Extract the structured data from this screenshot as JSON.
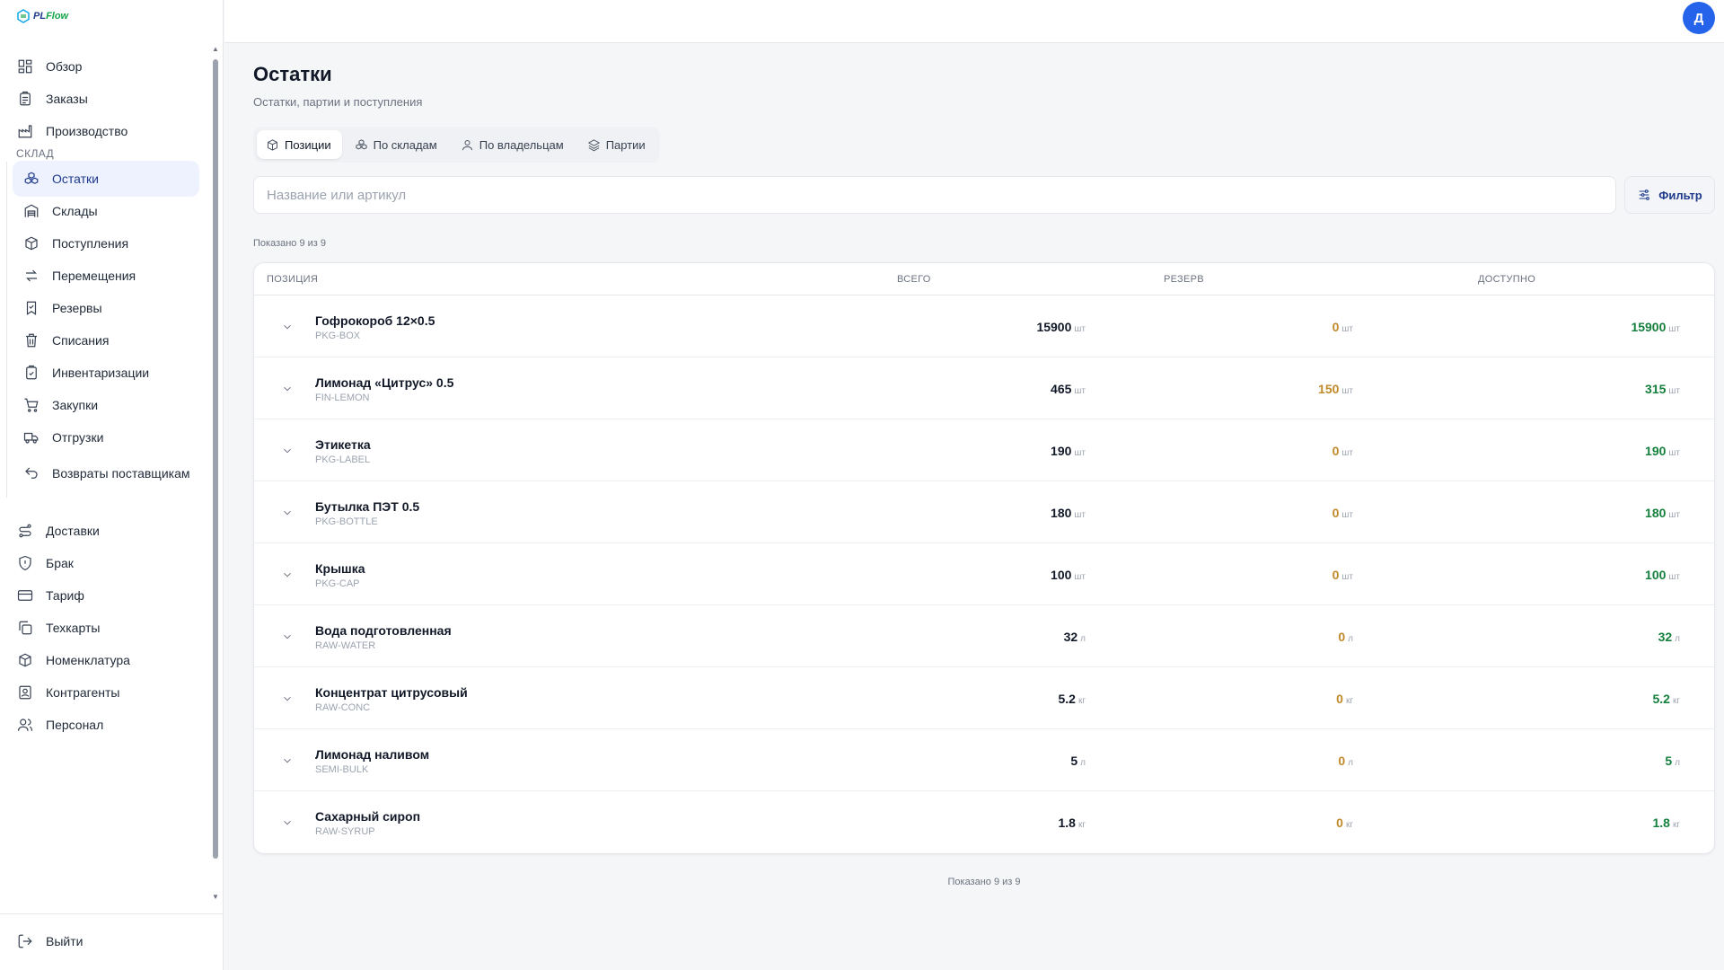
{
  "app": {
    "logo_main": "PL",
    "logo_accent": "Flow"
  },
  "user": {
    "avatar_letter": "Д"
  },
  "sidebar": {
    "top_items": [
      {
        "label": "Обзор",
        "icon": "dashboard-icon"
      },
      {
        "label": "Заказы",
        "icon": "clipboard-icon"
      },
      {
        "label": "Производство",
        "icon": "factory-icon"
      }
    ],
    "section_label": "СКЛАД",
    "warehouse_items": [
      {
        "label": "Остатки",
        "icon": "boxes-icon",
        "active": true
      },
      {
        "label": "Склады",
        "icon": "warehouse-icon"
      },
      {
        "label": "Поступления",
        "icon": "package-in-icon"
      },
      {
        "label": "Перемещения",
        "icon": "arrows-swap-icon"
      },
      {
        "label": "Резервы",
        "icon": "bookmark-icon"
      },
      {
        "label": "Списания",
        "icon": "trash-icon"
      },
      {
        "label": "Инвентаризации",
        "icon": "clipboard-check-icon"
      },
      {
        "label": "Закупки",
        "icon": "cart-icon"
      },
      {
        "label": "Отгрузки",
        "icon": "truck-icon"
      },
      {
        "label": "Возвраты поставщикам",
        "icon": "return-icon"
      }
    ],
    "bottom_items": [
      {
        "label": "Доставки",
        "icon": "route-icon"
      },
      {
        "label": "Брак",
        "icon": "shield-alert-icon"
      },
      {
        "label": "Тариф",
        "icon": "credit-card-icon"
      },
      {
        "label": "Техкарты",
        "icon": "copy-icon"
      },
      {
        "label": "Номенклатура",
        "icon": "box-icon"
      },
      {
        "label": "Контрагенты",
        "icon": "contact-icon"
      },
      {
        "label": "Персонал",
        "icon": "users-icon"
      }
    ],
    "logout_label": "Выйти"
  },
  "page": {
    "title": "Остатки",
    "subtitle": "Остатки, партии и поступления",
    "tabs": [
      {
        "label": "Позиции",
        "icon": "box-icon",
        "active": true
      },
      {
        "label": "По складам",
        "icon": "boxes-icon"
      },
      {
        "label": "По владельцам",
        "icon": "user-icon"
      },
      {
        "label": "Партии",
        "icon": "layers-icon"
      }
    ],
    "search_placeholder": "Название или артикул",
    "filter_label": "Фильтр",
    "shown_text": "Показано 9 из 9"
  },
  "table": {
    "headers": {
      "position": "Позиция",
      "total": "Всего",
      "reserve": "Резерв",
      "available": "Доступно"
    },
    "rows": [
      {
        "name": "Гофрокороб 12×0.5",
        "sku": "PKG-BOX",
        "total": "15900",
        "reserve": "0",
        "available": "15900",
        "unit": "шт"
      },
      {
        "name": "Лимонад «Цитрус» 0.5",
        "sku": "FIN-LEMON",
        "total": "465",
        "reserve": "150",
        "available": "315",
        "unit": "шт"
      },
      {
        "name": "Этикетка",
        "sku": "PKG-LABEL",
        "total": "190",
        "reserve": "0",
        "available": "190",
        "unit": "шт"
      },
      {
        "name": "Бутылка ПЭТ 0.5",
        "sku": "PKG-BOTTLE",
        "total": "180",
        "reserve": "0",
        "available": "180",
        "unit": "шт"
      },
      {
        "name": "Крышка",
        "sku": "PKG-CAP",
        "total": "100",
        "reserve": "0",
        "available": "100",
        "unit": "шт"
      },
      {
        "name": "Вода подготовленная",
        "sku": "RAW-WATER",
        "total": "32",
        "reserve": "0",
        "available": "32",
        "unit": "л"
      },
      {
        "name": "Концентрат цитрусовый",
        "sku": "RAW-CONC",
        "total": "5.2",
        "reserve": "0",
        "available": "5.2",
        "unit": "кг"
      },
      {
        "name": "Лимонад наливом",
        "sku": "SEMI-BULK",
        "total": "5",
        "reserve": "0",
        "available": "5",
        "unit": "л"
      },
      {
        "name": "Сахарный сироп",
        "sku": "RAW-SYRUP",
        "total": "1.8",
        "reserve": "0",
        "available": "1.8",
        "unit": "кг"
      }
    ]
  },
  "colors": {
    "accent": "#1e3a8a",
    "avatar": "#2563eb",
    "available": "#15803d",
    "reserve": "#c0892a"
  }
}
